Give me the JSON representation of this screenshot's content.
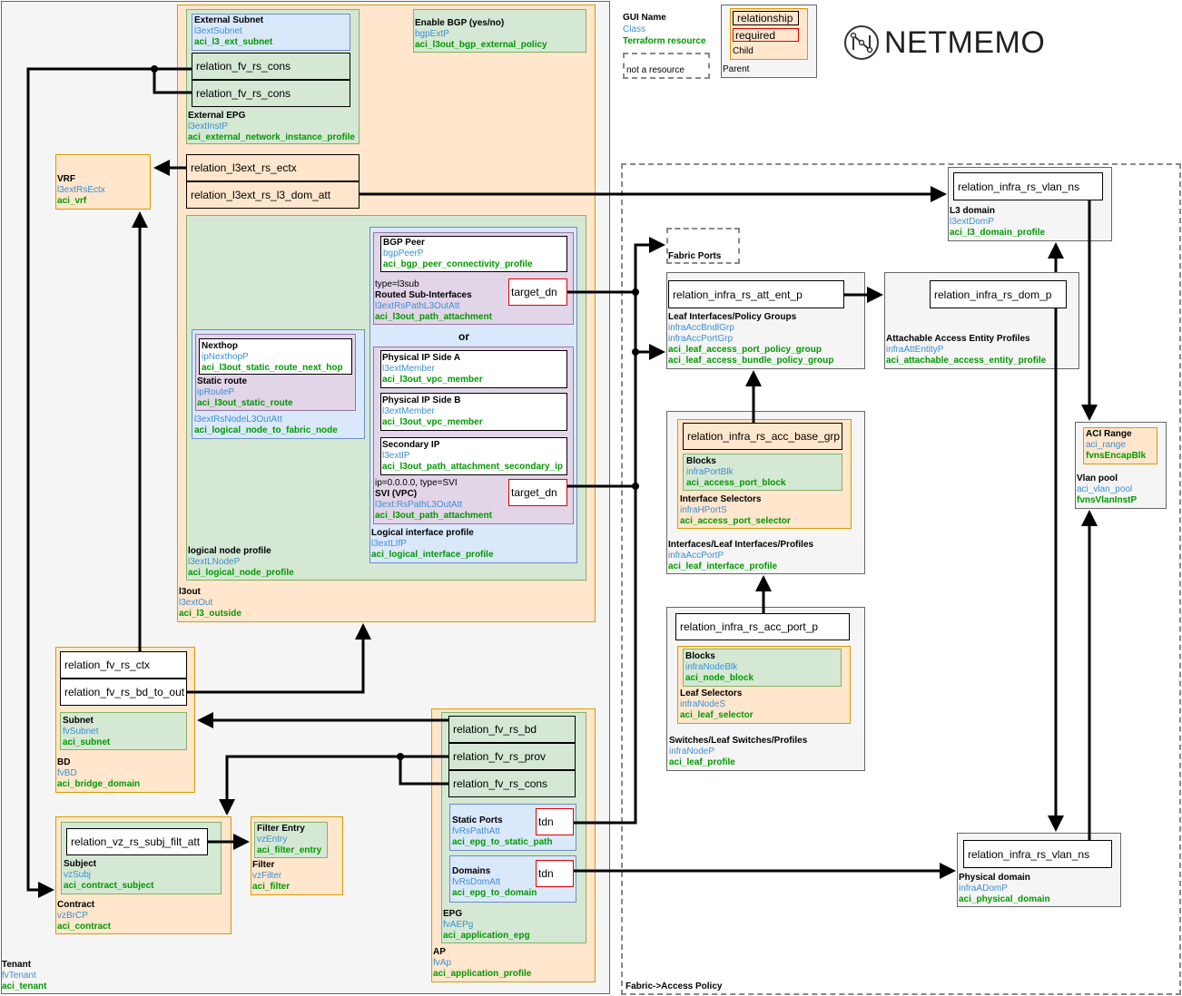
{
  "legend": {
    "gui_name": "GUI Name",
    "class": "Class",
    "terraform": "Terraform resource",
    "not_resource": "not a resource",
    "relationship": "relationship",
    "required": "required",
    "child": "Child",
    "parent": "Parent"
  },
  "logo": {
    "text": "NETMEMO"
  },
  "colors": {
    "class": "#3d8fd6",
    "terraform": "#009900",
    "required": "#e00000"
  },
  "tenant": {
    "name": "Tenant",
    "cls": "fvTenant",
    "tf": "aci_tenant",
    "l3out": {
      "name": "l3out",
      "cls": "l3extOut",
      "tf": "aci_l3_outside",
      "ext_subnet": {
        "name": "External Subnet",
        "cls": "l3extSubnet",
        "tf": "aci_l3_ext_subnet"
      },
      "ext_epg": {
        "name": "External EPG",
        "cls": "l3extInstP",
        "tf": "aci_external_network_instance_profile",
        "rel1": "relation_fv_rs_cons",
        "rel2": "relation_fv_rs_cons"
      },
      "bgp": {
        "name": "Enable BGP (yes/no)",
        "cls": "bgpExtP",
        "tf": "aci_l3out_bgp_external_policy"
      },
      "rel_ectx": "relation_l3ext_rs_ectx",
      "rel_dom": "relation_l3ext_rs_l3_dom_att",
      "lnp": {
        "name": "logical node profile",
        "cls": "l3extLNodeP",
        "tf": "aci_logical_node_profile",
        "node": {
          "cls": "l3extRsNodeL3OutAtt",
          "tf": "aci_logical_node_to_fabric_node"
        },
        "static_route": {
          "name": "Static route",
          "cls": "ipRouteP",
          "tf": "aci_l3out_static_route"
        },
        "nexthop": {
          "name": "Nexthop",
          "cls": "ipNexthopP",
          "tf": "aci_l3out_static_route_next_hop"
        },
        "lip": {
          "name": "Logical interface profile",
          "cls": "l3extLIfP",
          "tf": "aci_logical_interface_profile",
          "bgp_peer": {
            "name": "BGP Peer",
            "cls": "bgpPeerP",
            "tf": "aci_bgp_peer_connectivity_profile"
          },
          "rsi": {
            "note": "type=l3sub",
            "name": "Routed Sub-Interfaces",
            "cls": "l3extRsPathL3OutAtt",
            "tf": "aci_l3out_path_attachment",
            "target": "target_dn"
          },
          "or": "or",
          "side_a": {
            "name": "Physical IP Side A",
            "cls": "l3extMember",
            "tf": "aci_l3out_vpc_member"
          },
          "side_b": {
            "name": "Physical IP Side B",
            "cls": "l3extMember",
            "tf": "aci_l3out_vpc_member"
          },
          "secondary": {
            "name": "Secondary IP",
            "cls": "l3extIP",
            "tf": "aci_l3out_path_attachment_secondary_ip"
          },
          "svi": {
            "note": "ip=0.0.0.0, type=SVI",
            "name": "SVI (VPC)",
            "cls": "l3ext:RsPathL3OutAtt",
            "tf": "aci_l3out_path_attachment",
            "target": "target_dn"
          }
        }
      }
    },
    "vrf": {
      "name": "VRF",
      "cls": "l3extRsEctx",
      "tf": "aci_vrf"
    },
    "bd": {
      "name": "BD",
      "cls": "fvBD",
      "tf": "aci_bridge_domain",
      "rel_ctx": "relation_fv_rs_ctx",
      "rel_out": "relation_fv_rs_bd_to_out",
      "subnet": {
        "name": "Subnet",
        "cls": "fvSubnet",
        "tf": "aci_subnet"
      }
    },
    "contract": {
      "name": "Contract",
      "cls": "vzBrCP",
      "tf": "aci_contract",
      "subject": {
        "name": "Subject",
        "cls": "vzSubj",
        "tf": "aci_contract_subject",
        "rel": "relation_vz_rs_subj_filt_att"
      }
    },
    "filter": {
      "name": "Filter",
      "cls": "vzFilter",
      "tf": "aci_filter",
      "entry": {
        "name": "Filter Entry",
        "cls": "vzEntry",
        "tf": "aci_filter_entry"
      }
    },
    "ap": {
      "name": "AP",
      "cls": "fvAp",
      "tf": "aci_application_profile",
      "epg": {
        "name": "EPG",
        "cls": "fvAEPg",
        "tf": "aci_application_epg",
        "rel_bd": "relation_fv_rs_bd",
        "rel_prov": "relation_fv_rs_prov",
        "rel_cons": "relation_fv_rs_cons",
        "static_ports": {
          "name": "Static Ports",
          "cls": "fvRsPathAtt",
          "tf": "aci_epg_to_static_path",
          "tdn": "tdn"
        },
        "domains": {
          "name": "Domains",
          "cls": "fvRsDomAtt",
          "tf": "aci_epg_to_domain",
          "tdn": "tdn"
        }
      }
    }
  },
  "fabric": {
    "name": "Fabric->Access Policy",
    "fabric_ports": "Fabric Ports",
    "l3dom": {
      "name": "L3 domain",
      "cls": "l3extDomP",
      "tf": "aci_l3_domain_profile",
      "rel": "relation_infra_rs_vlan_ns"
    },
    "lipg": {
      "name": "Leaf Interfaces/Policy Groups",
      "cls1": "infraAccBndlGrp",
      "cls2": "infraAccPortGrp",
      "tf1": "aci_leaf_access_port_policy_group",
      "tf2": "aci_leaf_access_bundle_policy_group",
      "rel": "relation_infra_rs_att_ent_p"
    },
    "aaep": {
      "name": "Attachable Access Entity Profiles",
      "cls": "infraAttEntityP",
      "tf": "aci_attachable_access_entity_profile",
      "rel": "relation_infra_rs_dom_p"
    },
    "ilp": {
      "name": "Interfaces/Leaf Interfaces/Profiles",
      "cls": "infraAccPortP",
      "tf": "aci_leaf_interface_profile",
      "sel": {
        "name": "Interface Selectors",
        "cls": "infraHPortS",
        "tf": "aci_access_port_selector",
        "rel": "relation_infra_rs_acc_base_grp",
        "blocks": {
          "name": "Blocks",
          "cls": "infraPortBlk",
          "tf": "aci_access_port_block"
        }
      }
    },
    "slp": {
      "name": "Switches/Leaf Switches/Profiles",
      "cls": "infraNodeP",
      "tf": "aci_leaf_profile",
      "rel": "relation_infra_rs_acc_port_p",
      "sel": {
        "name": "Leaf Selectors",
        "cls": "infraNodeS",
        "tf": "aci_leaf_selector",
        "blocks": {
          "name": "Blocks",
          "cls": "infraNodeBlk",
          "tf": "aci_node_block"
        }
      }
    },
    "vlan": {
      "name": "Vlan pool",
      "cls": "aci_vlan_pool",
      "tf": "fvnsVlanInstP",
      "range": {
        "name": "ACI Range",
        "cls": "aci_range",
        "tf": "fvnsEncapBlk"
      }
    },
    "phys": {
      "name": "Physical domain",
      "cls": "infraADomP",
      "tf": "aci_physical_domain",
      "rel": "relation_infra_rs_vlan_ns"
    }
  }
}
